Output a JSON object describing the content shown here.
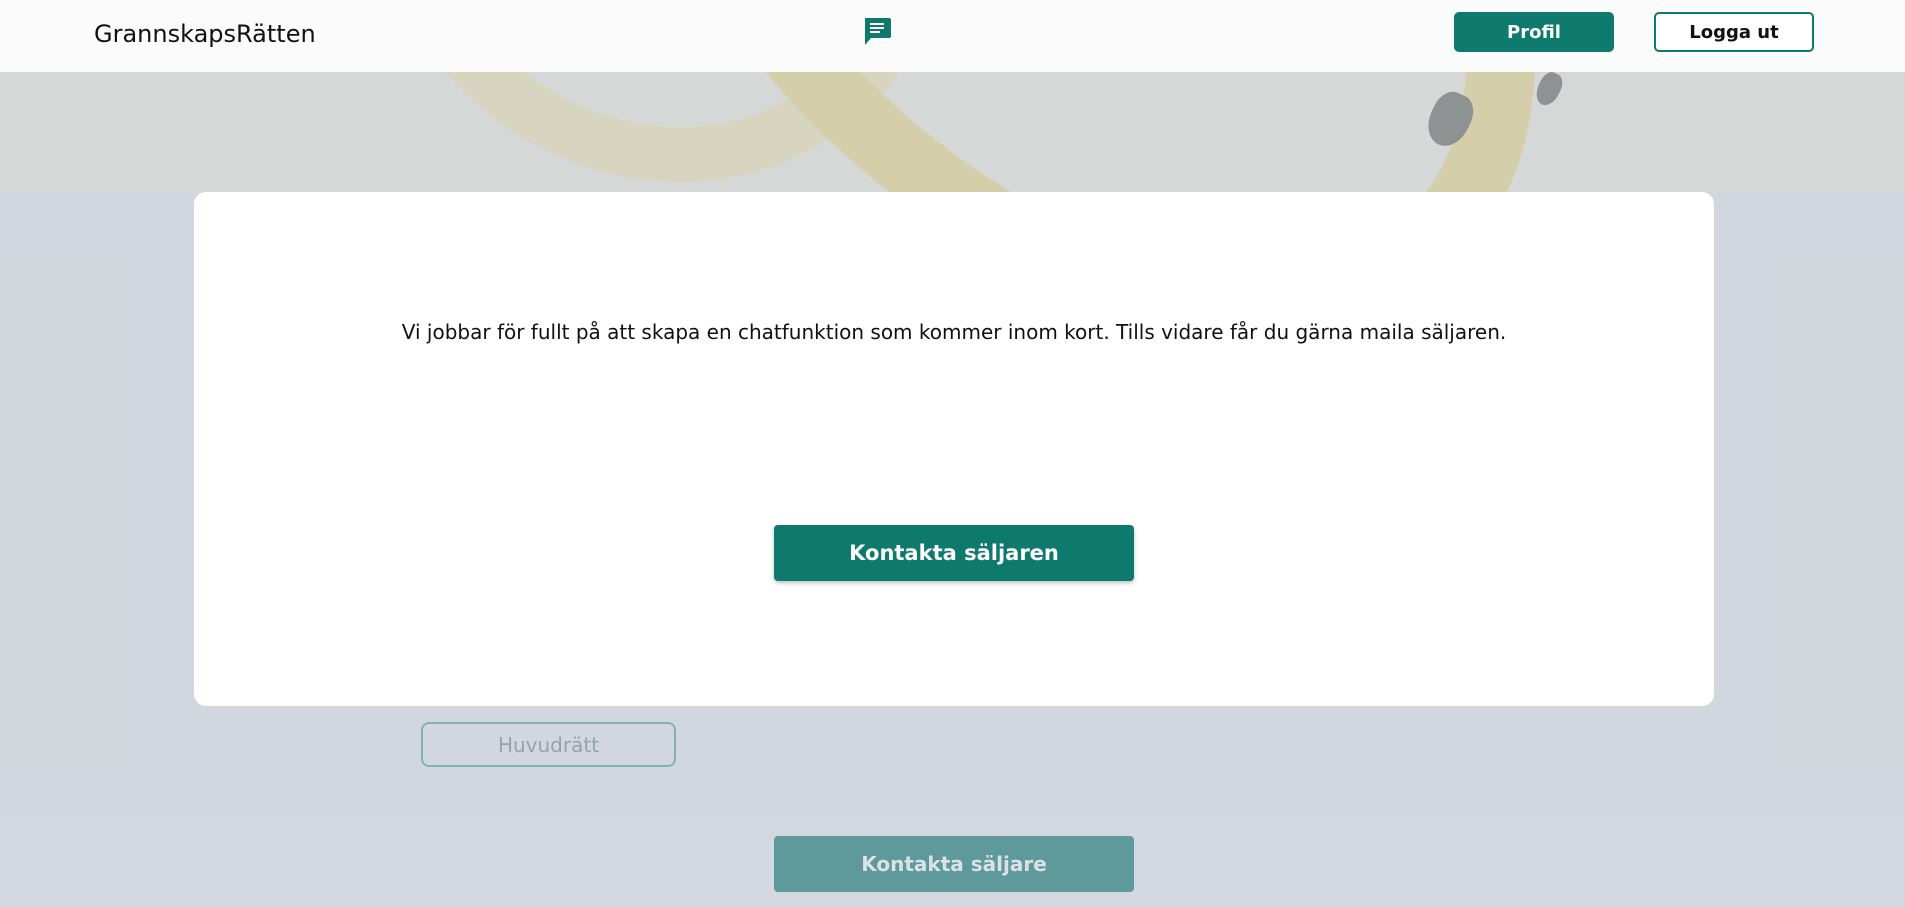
{
  "nav": {
    "brand": "GrannskapsRätten",
    "chat_icon": "chat-icon",
    "profile_label": "Profil",
    "logout_label": "Logga ut"
  },
  "background": {
    "tag_label": "Huvudrätt",
    "contact_label": "Kontakta säljare"
  },
  "modal": {
    "message": "Vi jobbar för fullt på att skapa en chatfunktion som kommer inom kort. Tills vidare får du gärna maila säljaren.",
    "contact_label": "Kontakta säljaren"
  },
  "colors": {
    "accent": "#0e7a6e",
    "overlay": "rgba(181,190,204,0.48)"
  }
}
